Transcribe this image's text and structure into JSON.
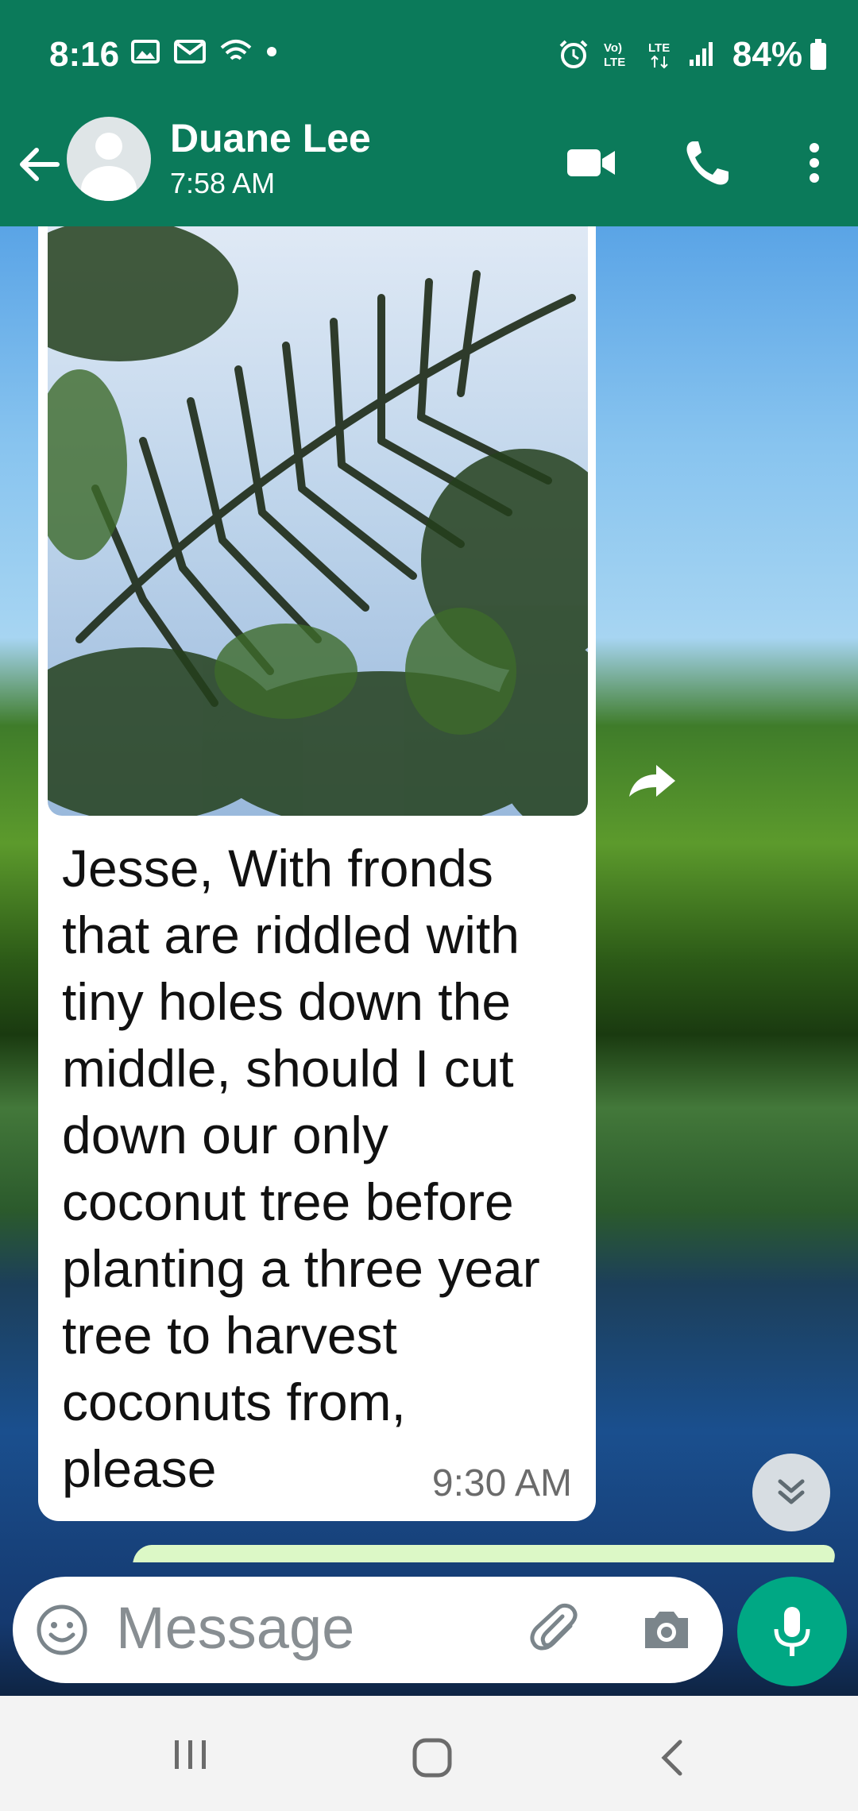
{
  "status_bar": {
    "time": "8:16",
    "battery": "84%",
    "icons_left": [
      "image-icon",
      "mail-icon",
      "wifi-icon",
      "dot-icon"
    ],
    "icons_right": [
      "alarm-icon",
      "volte-icon",
      "lte-icon",
      "signal-icon",
      "battery-icon"
    ]
  },
  "header": {
    "contact_name": "Duane Lee",
    "status": "7:58 AM",
    "icons": [
      "back-arrow-icon",
      "avatar",
      "video-call-icon",
      "voice-call-icon",
      "more-options-icon"
    ]
  },
  "message": {
    "text": "Jesse, With fronds that are riddled with tiny holes down the middle, should I cut down our only coconut tree before planting a three year tree to harvest coconuts from, please",
    "time": "9:30 AM",
    "has_photo": true,
    "photo_subject": "palm fronds against sky"
  },
  "input": {
    "placeholder": "Message"
  },
  "colors": {
    "header_bg": "#0b7a5a",
    "mic_button": "#00a884",
    "bubble_bg": "#ffffff",
    "outgoing_bubble": "#dcf8c6"
  }
}
